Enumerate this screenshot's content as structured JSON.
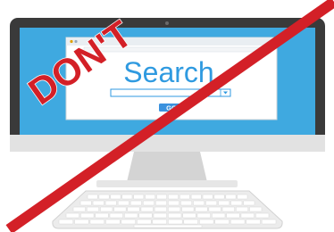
{
  "illustration": {
    "stamp_text": "DON'T",
    "colors": {
      "stamp_red": "#d32027",
      "monitor_dark": "#3a3a3a",
      "screen_blue": "#3fa9e0",
      "browser_white": "#ffffff",
      "search_blue": "#2f9ae0",
      "go_button": "#3b92de",
      "stand_gray": "#d9d9d9",
      "keyboard_gray": "#ececec"
    }
  },
  "browser": {
    "logo_text": "Search",
    "go_label": "GO"
  }
}
